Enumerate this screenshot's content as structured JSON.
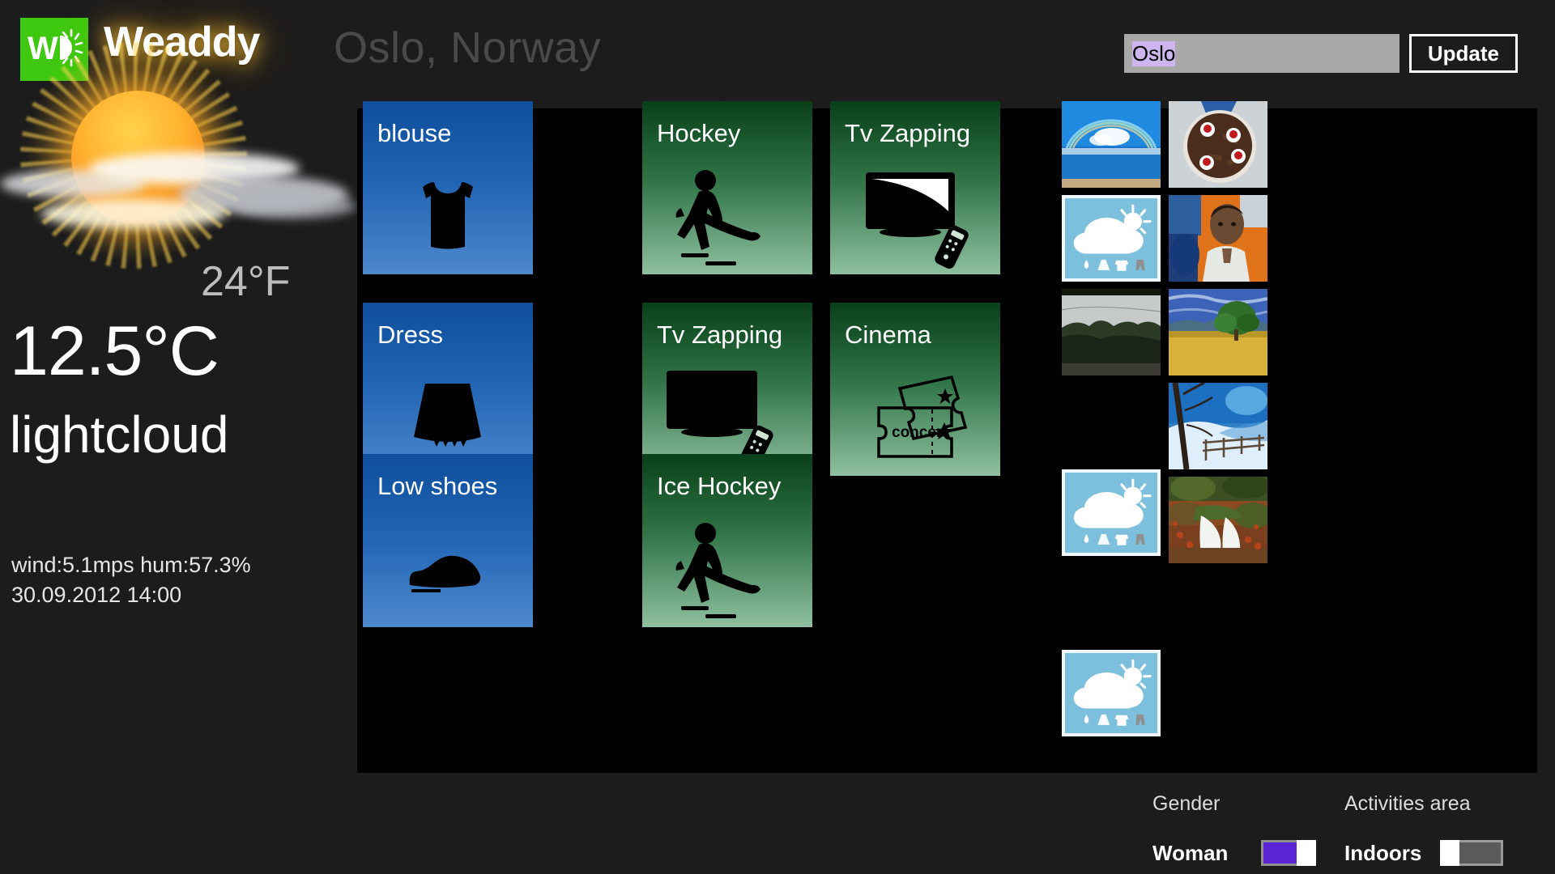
{
  "app": {
    "name": "Weaddy",
    "logo_letters": "W",
    "logo_bg_color": "#3ec80f"
  },
  "header": {
    "location_title": "Oslo, Norway",
    "search_value": "Oslo",
    "search_placeholder": "Oslo",
    "update_label": "Update"
  },
  "weather": {
    "temp_fahrenheit": "24°F",
    "temp_celsius": "12.5°C",
    "condition": "lightcloud",
    "wind_humidity": "wind:5.1mps hum:57.3%",
    "timestamp": "30.09.2012 14:00",
    "icon": "sun-behind-cloud-icon"
  },
  "clothing_tiles": [
    {
      "label": "blouse",
      "icon": "tank-top-icon"
    },
    {
      "label": "Dress",
      "icon": "skirt-icon"
    },
    {
      "label": "Low shoes",
      "icon": "shoe-icon"
    }
  ],
  "activity_tiles": [
    {
      "label": "Hockey",
      "icon": "hockey-player-icon",
      "col": 0,
      "row": 0
    },
    {
      "label": "Tv Zapping",
      "icon": "tv-remote-icon",
      "col": 1,
      "row": 0
    },
    {
      "label": "Tv Zapping",
      "icon": "tv-remote-icon",
      "col": 0,
      "row": 1
    },
    {
      "label": "Cinema",
      "icon": "concert-tickets-icon",
      "col": 1,
      "row": 1
    },
    {
      "label": "Ice Hockey",
      "icon": "hockey-player-icon",
      "col": 0,
      "row": 2
    }
  ],
  "cinema_ticket_text": "concert",
  "thumbnails": [
    {
      "name": "rainbow-beach-photo",
      "kind": "photo-rainbow"
    },
    {
      "name": "chocolate-cake-photo",
      "kind": "photo-cake"
    },
    {
      "name": "weather-app-icon",
      "kind": "weather-icon"
    },
    {
      "name": "person-desk-photo",
      "kind": "photo-person"
    },
    {
      "name": "overcast-road-photo",
      "kind": "photo-overcast"
    },
    {
      "name": "field-tree-photo",
      "kind": "photo-field"
    },
    {
      "name": "weather-app-icon",
      "kind": "weather-icon"
    },
    {
      "name": "winter-fence-photo",
      "kind": "photo-winter"
    },
    {
      "name": "weather-app-icon",
      "kind": "weather-icon"
    },
    {
      "name": "autumn-stream-photo",
      "kind": "photo-autumn"
    }
  ],
  "controls": {
    "gender": {
      "title": "Gender",
      "value": "Woman",
      "state": "on",
      "accent_color": "#5b24d6"
    },
    "activities_area": {
      "title": "Activities area",
      "value": "Indoors",
      "state": "off",
      "accent_color": "#5a5a5a"
    }
  },
  "colors": {
    "background": "#1c1c1c",
    "panel": "#000000",
    "clothing_tile": "#1f63b3",
    "activity_tile": "#2f7346",
    "title_gray": "#4a4a4a"
  }
}
